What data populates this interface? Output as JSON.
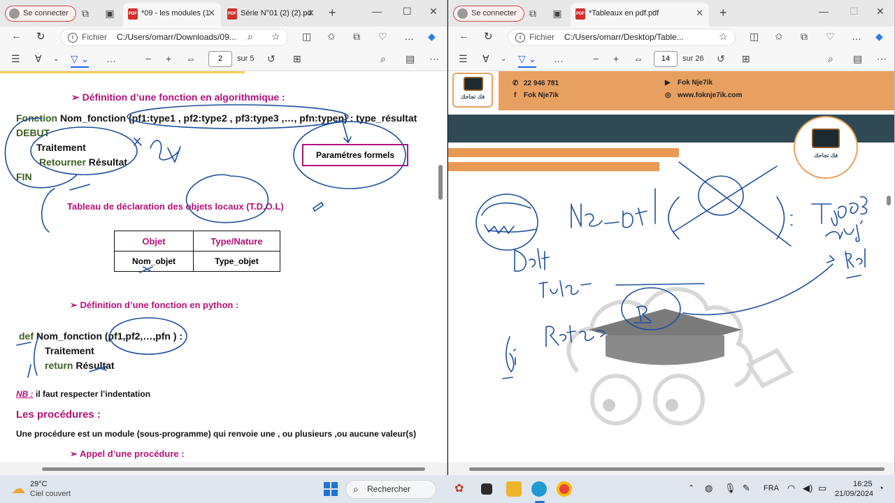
{
  "left_window": {
    "profile_label": "Se connecter",
    "tabs": [
      {
        "label": "*09 - les modules (1",
        "active": true
      },
      {
        "label": "Série N°01 (2) (2).pd",
        "active": false
      }
    ],
    "address": {
      "label": "Fichier",
      "url": "C:/Users/omarr/Downloads/09..."
    },
    "pdf_toolbar": {
      "page": "2",
      "page_total": "sur 5"
    },
    "document": {
      "h_def_algo": "Définition d’une fonction en algorithmique :",
      "fonction_kw": "Fonction",
      "fonction_sig": " Nom_fonction (pf1:type1 , pf2:type2 , pf3:type3 ,…, pfn:typen) : type_résultat",
      "debut": "DEBUT",
      "traitement": "Traitement",
      "retourner_kw": "Retourner",
      "resultat": " Résultat",
      "fin": "FIN",
      "param_formels": "Paramétres formels",
      "tdol_title": "Tableau de déclaration des objets locaux (T.D.O.L)",
      "tdol_headers": [
        "Objet",
        "Type/Nature"
      ],
      "tdol_row": [
        "Nom_objet",
        "Type_objet"
      ],
      "h_def_python": "Définition d’une fonction en python :",
      "def_kw": "def",
      "def_sig": " Nom_fonction (pf1,pf2,…,pfn ) :",
      "py_traitement": "Traitement",
      "return_kw": "return",
      "py_resultat": " Résultat",
      "nb_label": "NB :",
      "nb_text": " il faut respecter l’indentation",
      "h_procedures": "Les procédures :",
      "proc_text": "Une procédure est un module (sous-programme) qui renvoie une , ou plusieurs ,ou aucune valeur(s)",
      "h_appel": "Appel d’une procédure :"
    }
  },
  "right_window": {
    "profile_label": "Se connecter",
    "tabs": [
      {
        "label": "*Tableaux en pdf.pdf",
        "active": true
      }
    ],
    "address": {
      "label": "Fichier",
      "url": "C:/Users/omarr/Desktop/Table..."
    },
    "pdf_toolbar": {
      "page": "14",
      "page_total": "sur 26"
    },
    "banner": {
      "phone": "22 946 781",
      "facebook": "Fok Nje7ik",
      "youtube": "Fok Nje7ik",
      "website": "www.foknje7ik.com",
      "logo_text": "فك تجاحك"
    }
  },
  "taskbar": {
    "weather_temp": "29°C",
    "weather_desc": "Ciel couvert",
    "search_placeholder": "Rechercher",
    "language": "FRA",
    "time": "16:25",
    "date": "21/09/2024"
  },
  "colors": {
    "heading_magenta": "#b5127a",
    "keyword_green": "#3b5f20",
    "pen_blue": "#1d4f9c",
    "banner_orange": "#e8a060",
    "banner_navy": "#2f4a55"
  }
}
